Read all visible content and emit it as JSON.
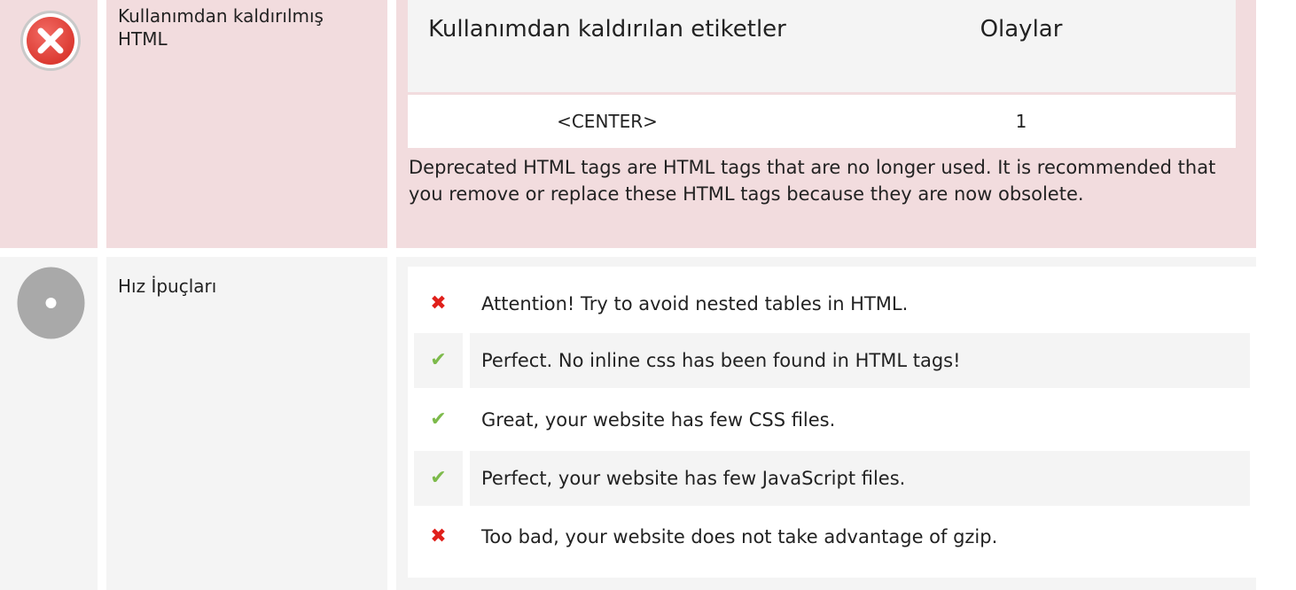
{
  "deprecated": {
    "title": "Kullanımdan kaldırılmış HTML",
    "table": {
      "headers": [
        "Kullanımdan kaldırılan etiketler",
        "Olaylar"
      ],
      "rows": [
        {
          "tag": "<CENTER>",
          "count": "1"
        }
      ]
    },
    "description": "Deprecated HTML tags are HTML tags that are no longer used. It is recommended that you remove or replace these HTML tags because they are now obsolete."
  },
  "speed": {
    "title": "Hız İpuçları",
    "tips": [
      {
        "status": "bad",
        "icon": "cross-icon",
        "text": "Attention! Try to avoid nested tables in HTML."
      },
      {
        "status": "good",
        "icon": "check-icon",
        "text": "Perfect. No inline css has been found in HTML tags!"
      },
      {
        "status": "good",
        "icon": "check-icon",
        "text": "Great, your website has few CSS files."
      },
      {
        "status": "good",
        "icon": "check-icon",
        "text": "Perfect, your website has few JavaScript files."
      },
      {
        "status": "bad",
        "icon": "cross-icon",
        "text": "Too bad, your website does not take advantage of gzip."
      }
    ]
  },
  "colors": {
    "error_bg": "#f2dcde",
    "neutral_bg": "#f4f4f4",
    "error_red": "#e0201b",
    "success_green": "#7dba4b"
  }
}
